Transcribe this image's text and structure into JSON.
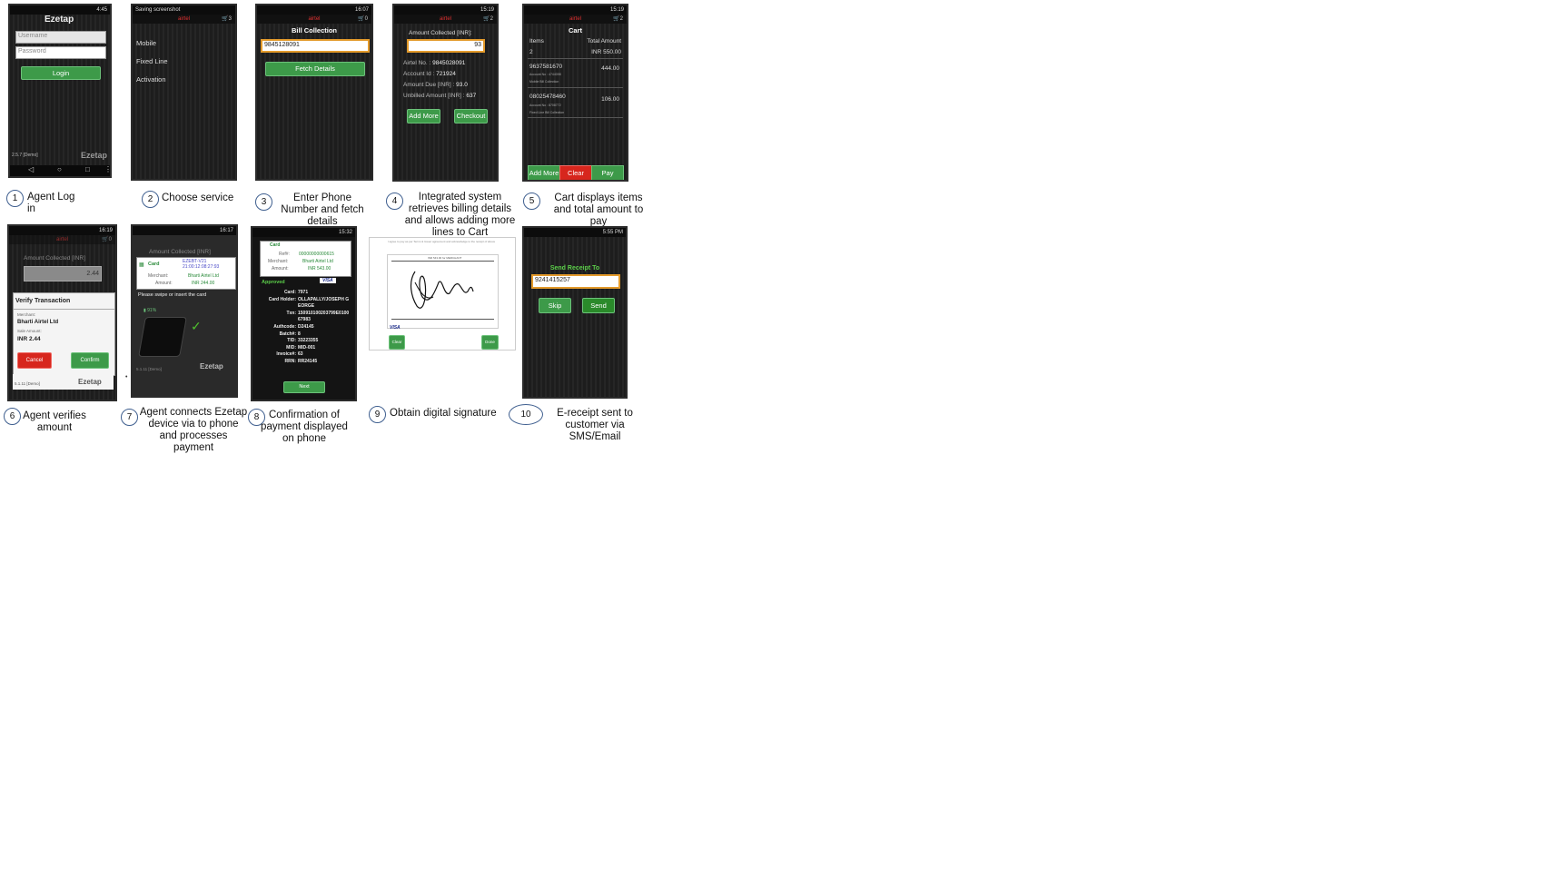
{
  "steps": [
    {
      "number": "1",
      "caption": "Agent Log in"
    },
    {
      "number": "2",
      "caption": "Choose service"
    },
    {
      "number": "3",
      "caption": "Enter Phone Number and fetch details"
    },
    {
      "number": "4",
      "caption": "Integrated system retrieves billing details and allows adding more lines to Cart"
    },
    {
      "number": "5",
      "caption": "Cart displays items and total amount to pay"
    },
    {
      "number": "6",
      "caption": "Agent verifies amount"
    },
    {
      "number": "7",
      "caption": "Agent connects Ezetap device via to phone and processes payment"
    },
    {
      "number": "8",
      "caption": "Confirmation of payment displayed on phone"
    },
    {
      "number": "9",
      "caption": "Obtain digital signature"
    },
    {
      "number": "10",
      "caption": "E-receipt sent to customer via SMS/Email"
    }
  ],
  "screen1": {
    "time": "4:45",
    "brand": "Ezetap",
    "username_placeholder": "Username",
    "password_placeholder": "Password",
    "login_label": "Login",
    "version": "2.5.7 [Demo]",
    "footer_brand": "Ezetap"
  },
  "screen2": {
    "status": "Saving screenshot",
    "carrier": "airtel",
    "cart_count": "3",
    "menu": [
      "Mobile",
      "Fixed Line",
      "Activation"
    ]
  },
  "screen3": {
    "time": "16:07",
    "carrier": "airtel",
    "cart_count": "0",
    "title": "Bill Collection",
    "phone_value": "9845128091",
    "fetch_label": "Fetch Details"
  },
  "screen4": {
    "time": "15:19",
    "battery": "66%",
    "carrier": "airtel",
    "cart_count": "2",
    "amount_label": "Amount Collected [INR]:",
    "amount_value": "93",
    "details": [
      {
        "label": "Airtel No.",
        "value": "9845028091"
      },
      {
        "label": "Account Id",
        "value": "721924"
      },
      {
        "label": "Amount Due [INR]",
        "value": "93.0"
      },
      {
        "label": "Unbilled Amount [INR]",
        "value": "637"
      }
    ],
    "add_more_label": "Add More",
    "checkout_label": "Checkout"
  },
  "screen5": {
    "time": "15:19",
    "battery": "66%",
    "carrier": "airtel",
    "cart_count": "2",
    "title": "Cart",
    "items_header": "Items",
    "total_header": "Total Amount",
    "items_count": "2",
    "total_amount": "INR 550.00",
    "rows": [
      {
        "number": "9637581670",
        "amount": "444.00",
        "account": "Account No : 4744098",
        "type": "Mobile     Bill Collection"
      },
      {
        "number": "08025478460",
        "amount": "106.00",
        "account": "Account No : 8708772",
        "type": "Fixed Line     Bill Collection"
      }
    ],
    "add_more_label": "Add More",
    "clear_label": "Clear",
    "pay_label": "Pay"
  },
  "screen6": {
    "time": "16:19",
    "battery": "54%",
    "carrier": "airtel",
    "cart_count": "0",
    "amount_label": "Amount Collected [INR]",
    "amount_value": "2.44",
    "dialog_title": "Verify Transaction",
    "merchant_label": "Merchant:",
    "merchant_value": "Bharti Airtel Ltd",
    "sale_label": "Sale Amount:",
    "sale_value": "INR 2.44",
    "cancel_label": "Cancel",
    "confirm_label": "Confirm",
    "version": "5.1.11 [Demo]",
    "brand": "Ezetap"
  },
  "screen7": {
    "time": "16:17",
    "amount_label": "Amount Collected [INR]",
    "card_label": "Card",
    "ref_line1": "EZEBT-V21",
    "ref_line2": "21:00:12:08:27:93",
    "merchant_label": "Merchant:",
    "merchant_value": "Bharti Airtel Ltd",
    "amount_key": "Amount:",
    "amount_value": "INR 244.00",
    "instruction": "Please swipe or insert the card",
    "device_battery": "91%",
    "version": "5.1.11 [Demo]",
    "brand": "Ezetap"
  },
  "screen8": {
    "time": "15:32",
    "battery": "61%",
    "card_label": "Card",
    "ref_key": "Ref#:",
    "ref_value": "00000000000615",
    "merchant_key": "Merchant:",
    "merchant_value": "Bharti Airtel Ltd",
    "amount_key": "Amount:",
    "amount_value": "INR 543.00",
    "approved_label": "Approved",
    "visa_label": "VISA",
    "details": [
      {
        "label": "Card:",
        "value": "7971"
      },
      {
        "label": "Card Holder:",
        "value": "OLLAPALLY/JOSEPH GEORGE"
      },
      {
        "label": "Txn:",
        "value": "150910100203799E010067983"
      },
      {
        "label": "Authcode:",
        "value": "D24145"
      },
      {
        "label": "Batch#:",
        "value": "8"
      },
      {
        "label": "TID:",
        "value": "33223355"
      },
      {
        "label": "MID:",
        "value": "MID-001"
      },
      {
        "label": "Invoice#:",
        "value": "63"
      },
      {
        "label": "RRN:",
        "value": "RR24145"
      }
    ],
    "next_label": "Next"
  },
  "screen9": {
    "header_text": "I agree to pay as per Terms & Issuer agreement and acknowledge to the receipt of above",
    "amount_text": "INR 543.00 for MERCHANT",
    "visa_label": "VISA",
    "clear_label": "Clear",
    "done_label": "Done"
  },
  "screen10": {
    "time": "5:55 PM",
    "title": "Send Receipt To",
    "phone_value": "9241415257",
    "skip_label": "Skip",
    "send_label": "Send"
  },
  "colors": {
    "accent_green": "#3d9a49",
    "accent_red": "#d7261d",
    "field_border": "#e39a2b",
    "screen_bg": "#1b1b1b",
    "circle_border": "#3f5f8f"
  }
}
